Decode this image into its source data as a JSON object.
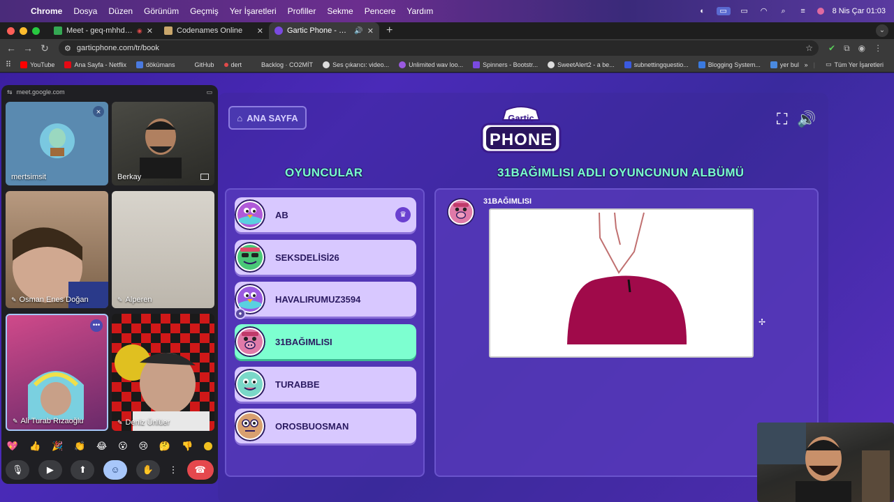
{
  "menubar": {
    "app": "Chrome",
    "items": [
      "Dosya",
      "Düzen",
      "Görünüm",
      "Geçmiş",
      "Yer İşaretleri",
      "Profiller",
      "Sekme",
      "Pencere",
      "Yardım"
    ],
    "datetime": "8 Nis Çar  01:03"
  },
  "tabs": [
    {
      "title": "Meet - geq-mhhd-zzq",
      "color": "#34a853"
    },
    {
      "title": "Codenames Online",
      "color": "#c9a66b"
    },
    {
      "title": "Gartic Phone - Kulaktan K",
      "color": "#7a4ae0"
    }
  ],
  "address": {
    "url": "garticphone.com/tr/book"
  },
  "bookmarks": {
    "items": [
      {
        "label": "YouTube",
        "color": "#ff0000"
      },
      {
        "label": "Ana Sayfa - Netflix",
        "color": "#e50914"
      },
      {
        "label": "dökümans",
        "color": "#4a7ae0"
      },
      {
        "label": "GitHub",
        "color": "#3a3a3a"
      },
      {
        "label": "dert",
        "color": "#e04a4a"
      },
      {
        "label": "Backlog · CO2MİT",
        "color": "#3a3a3a"
      },
      {
        "label": "Ses çıkarıcı: video...",
        "color": "#dddddd"
      },
      {
        "label": "Unlimited wav loo...",
        "color": "#9a5ae0"
      },
      {
        "label": "Spinners - Bootstr...",
        "color": "#7a4ae0"
      },
      {
        "label": "SweetAlert2 - a be...",
        "color": "#dddddd"
      },
      {
        "label": "subnettingquestio...",
        "color": "#3a5ae0"
      },
      {
        "label": "Blogging System...",
        "color": "#3a7ae0"
      },
      {
        "label": "yer bul",
        "color": "#4a8ae0"
      }
    ],
    "all_label": "Tüm Yer İşaretleri"
  },
  "game": {
    "home_label": "ANA SAYFA",
    "logo_top": "Gartic",
    "logo_bottom": "PHONE",
    "players_heading": "OYUNCULAR",
    "album_heading": "31BAĞIMLISI ADLI OYUNCUNUN ALBÜMÜ",
    "album_owner": "31BAĞIMLISI",
    "players": [
      {
        "name": "AB",
        "avatar_color": "#b05ad8",
        "active": false,
        "host": true
      },
      {
        "name": "SEKSDELİSİ26",
        "avatar_color": "#4ac878",
        "active": false,
        "host": false
      },
      {
        "name": "HAVALIRUMUZ3594",
        "avatar_color": "#9a5ae0",
        "active": false,
        "host": false
      },
      {
        "name": "31BAĞIMLISI",
        "avatar_color": "#e07aa8",
        "active": true,
        "host": false
      },
      {
        "name": "TURABBE",
        "avatar_color": "#7ad8c8",
        "active": false,
        "host": false
      },
      {
        "name": "OROSBUOSMAN",
        "avatar_color": "#d8a070",
        "active": false,
        "host": false
      }
    ]
  },
  "meet": {
    "host": "meet.google.com",
    "tiles": [
      "mertsimsit",
      "Berkay",
      "Osman Enes Doğan",
      "Alperen",
      "Ali Turab Rızaoğlu",
      "Deniz Ünlüer"
    ],
    "reactions": [
      "💖",
      "👍",
      "🎉",
      "👏",
      "😂",
      "😮",
      "😢",
      "🤔",
      "👎"
    ]
  }
}
